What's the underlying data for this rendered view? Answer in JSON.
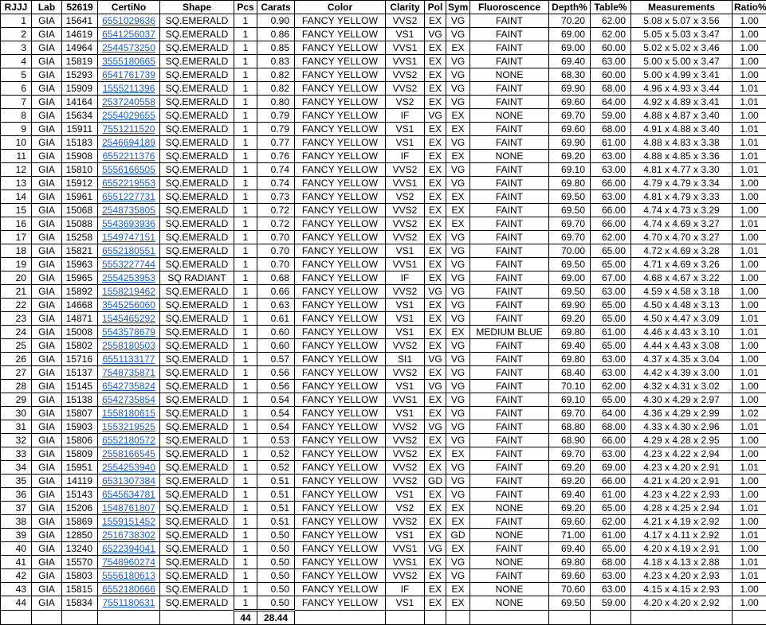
{
  "headers": [
    "RJJJ",
    "Lab",
    "52619",
    "CertiNo",
    "Shape",
    "Pcs",
    "Carats",
    "Color",
    "Clarity",
    "Pol",
    "Sym",
    "Fluoroscence",
    "Depth%",
    "Table%",
    "Measurements",
    "Ratio%"
  ],
  "rows": [
    [
      "1",
      "GIA",
      "15641",
      "6551029636",
      "SQ.EMERALD",
      "1",
      "0.90",
      "FANCY  YELLOW",
      "VVS2",
      "EX",
      "VG",
      "FAINT",
      "70.20",
      "62.00",
      "5.08 x 5.07 x 3.56",
      "1.00"
    ],
    [
      "2",
      "GIA",
      "14619",
      "6541256037",
      "SQ.EMERALD",
      "1",
      "0.86",
      "FANCY  YELLOW",
      "VS1",
      "VG",
      "VG",
      "FAINT",
      "69.00",
      "62.00",
      "5.05 x 5.03 x 3.47",
      "1.00"
    ],
    [
      "3",
      "GIA",
      "14964",
      "2544573250",
      "SQ.EMERALD",
      "1",
      "0.85",
      "FANCY  YELLOW",
      "VVS1",
      "EX",
      "EX",
      "FAINT",
      "69.00",
      "60.00",
      "5.02 x 5.02 x 3.46",
      "1.00"
    ],
    [
      "4",
      "GIA",
      "15819",
      "3555180665",
      "SQ.EMERALD",
      "1",
      "0.83",
      "FANCY  YELLOW",
      "VVS1",
      "EX",
      "VG",
      "FAINT",
      "69.40",
      "63.00",
      "5.00 x 5.00 x 3.47",
      "1.00"
    ],
    [
      "5",
      "GIA",
      "15293",
      "6541761739",
      "SQ.EMERALD",
      "1",
      "0.82",
      "FANCY  YELLOW",
      "VVS2",
      "EX",
      "VG",
      "NONE",
      "68.30",
      "60.00",
      "5.00 x 4.99 x 3.41",
      "1.00"
    ],
    [
      "6",
      "GIA",
      "15909",
      "1555211396",
      "SQ.EMERALD",
      "1",
      "0.82",
      "FANCY  YELLOW",
      "VVS2",
      "EX",
      "VG",
      "FAINT",
      "69.90",
      "68.00",
      "4.96 x 4.93 x 3.44",
      "1.01"
    ],
    [
      "7",
      "GIA",
      "14164",
      "2537240558",
      "SQ.EMERALD",
      "1",
      "0.80",
      "FANCY  YELLOW",
      "VS2",
      "EX",
      "VG",
      "FAINT",
      "69.60",
      "64.00",
      "4.92 x 4.89 x 3.41",
      "1.01"
    ],
    [
      "8",
      "GIA",
      "15634",
      "2554029655",
      "SQ.EMERALD",
      "1",
      "0.79",
      "FANCY  YELLOW",
      "IF",
      "VG",
      "EX",
      "NONE",
      "69.70",
      "59.00",
      "4.88 x 4.87 x 3.40",
      "1.00"
    ],
    [
      "9",
      "GIA",
      "15911",
      "7551211520",
      "SQ.EMERALD",
      "1",
      "0.79",
      "FANCY  YELLOW",
      "VS1",
      "EX",
      "EX",
      "FAINT",
      "69.60",
      "68.00",
      "4.91 x 4.88 x 3.40",
      "1.01"
    ],
    [
      "10",
      "GIA",
      "15183",
      "2546694189",
      "SQ.EMERALD",
      "1",
      "0.77",
      "FANCY  YELLOW",
      "VS1",
      "EX",
      "VG",
      "FAINT",
      "69.90",
      "61.00",
      "4.88 x 4.83 x 3.38",
      "1.01"
    ],
    [
      "11",
      "GIA",
      "15908",
      "6552211376",
      "SQ.EMERALD",
      "1",
      "0.76",
      "FANCY  YELLOW",
      "IF",
      "EX",
      "EX",
      "NONE",
      "69.20",
      "63.00",
      "4.88 x 4.85 x 3.36",
      "1.01"
    ],
    [
      "12",
      "GIA",
      "15810",
      "5556166505",
      "SQ.EMERALD",
      "1",
      "0.74",
      "FANCY  YELLOW",
      "VVS2",
      "EX",
      "VG",
      "FAINT",
      "69.10",
      "63.00",
      "4.81 x 4.77 x 3.30",
      "1.01"
    ],
    [
      "13",
      "GIA",
      "15912",
      "6552219553",
      "SQ.EMERALD",
      "1",
      "0.74",
      "FANCY  YELLOW",
      "VVS1",
      "EX",
      "VG",
      "FAINT",
      "69.80",
      "66.00",
      "4.79 x 4.79 x 3.34",
      "1.00"
    ],
    [
      "14",
      "GIA",
      "15961",
      "6551227731",
      "SQ.EMERALD",
      "1",
      "0.73",
      "FANCY  YELLOW",
      "VS2",
      "EX",
      "EX",
      "FAINT",
      "69.50",
      "63.00",
      "4.81 x 4.79 x 3.33",
      "1.00"
    ],
    [
      "15",
      "GIA",
      "15068",
      "2548735805",
      "SQ.EMERALD",
      "1",
      "0.72",
      "FANCY  YELLOW",
      "VVS2",
      "EX",
      "EX",
      "FAINT",
      "69.50",
      "66.00",
      "4.74 x 4.73 x 3.29",
      "1.00"
    ],
    [
      "16",
      "GIA",
      "15088",
      "5543693936",
      "SQ.EMERALD",
      "1",
      "0.72",
      "FANCY  YELLOW",
      "VVS2",
      "EX",
      "EX",
      "FAINT",
      "69.70",
      "66.00",
      "4.74 x 4.69 x 3.27",
      "1.01"
    ],
    [
      "17",
      "GIA",
      "15258",
      "1549747151",
      "SQ.EMERALD",
      "1",
      "0.70",
      "FANCY  YELLOW",
      "VVS2",
      "EX",
      "VG",
      "FAINT",
      "69.70",
      "62.00",
      "4.70 x 4.70 x 3.27",
      "1.00"
    ],
    [
      "18",
      "GIA",
      "15821",
      "6552180551",
      "SQ.EMERALD",
      "1",
      "0.70",
      "FANCY  YELLOW",
      "VS1",
      "EX",
      "VG",
      "FAINT",
      "70.00",
      "65.00",
      "4.72 x 4.69 x 3.28",
      "1.01"
    ],
    [
      "19",
      "GIA",
      "15963",
      "5553227744",
      "SQ.EMERALD",
      "1",
      "0.70",
      "FANCY  YELLOW",
      "VVS1",
      "EX",
      "VG",
      "FAINT",
      "69.50",
      "65.00",
      "4.71 x 4.69 x 3.26",
      "1.00"
    ],
    [
      "20",
      "GIA",
      "15965",
      "2554253953",
      "SQ RADIANT",
      "1",
      "0.68",
      "FANCY  YELLOW",
      "IF",
      "EX",
      "VG",
      "FAINT",
      "69.00",
      "67.00",
      "4.68 x 4.67 x 3.22",
      "1.00"
    ],
    [
      "21",
      "GIA",
      "15892",
      "1558219462",
      "SQ.EMERALD",
      "1",
      "0.66",
      "FANCY  YELLOW",
      "VVS2",
      "VG",
      "VG",
      "FAINT",
      "69.50",
      "63.00",
      "4.59 x 4.58 x 3.18",
      "1.00"
    ],
    [
      "22",
      "GIA",
      "14668",
      "3545256060",
      "SQ.EMERALD",
      "1",
      "0.63",
      "FANCY  YELLOW",
      "VS1",
      "EX",
      "VG",
      "FAINT",
      "69.90",
      "65.00",
      "4.50 x 4.48 x 3.13",
      "1.00"
    ],
    [
      "23",
      "GIA",
      "14871",
      "1545465292",
      "SQ.EMERALD",
      "1",
      "0.61",
      "FANCY  YELLOW",
      "VS1",
      "EX",
      "VG",
      "FAINT",
      "69.20",
      "65.00",
      "4.50 x 4.47 x 3.09",
      "1.01"
    ],
    [
      "24",
      "GIA",
      "15008",
      "5543578679",
      "SQ.EMERALD",
      "1",
      "0.60",
      "FANCY  YELLOW",
      "VS1",
      "EX",
      "EX",
      "MEDIUM BLUE",
      "69.80",
      "61.00",
      "4.46 x 4.43 x 3.10",
      "1.01"
    ],
    [
      "25",
      "GIA",
      "15802",
      "2558180503",
      "SQ.EMERALD",
      "1",
      "0.60",
      "FANCY  YELLOW",
      "VVS2",
      "EX",
      "VG",
      "FAINT",
      "69.40",
      "65.00",
      "4.44 x 4.43 x 3.08",
      "1.00"
    ],
    [
      "26",
      "GIA",
      "15716",
      "6551133177",
      "SQ.EMERALD",
      "1",
      "0.57",
      "FANCY  YELLOW",
      "SI1",
      "VG",
      "VG",
      "FAINT",
      "69.80",
      "63.00",
      "4.37 x 4.35 x 3.04",
      "1.00"
    ],
    [
      "27",
      "GIA",
      "15137",
      "7548735871",
      "SQ.EMERALD",
      "1",
      "0.56",
      "FANCY  YELLOW",
      "VVS2",
      "EX",
      "VG",
      "FAINT",
      "68.40",
      "63.00",
      "4.42 x 4.39 x 3.00",
      "1.01"
    ],
    [
      "28",
      "GIA",
      "15145",
      "6542735824",
      "SQ.EMERALD",
      "1",
      "0.56",
      "FANCY  YELLOW",
      "VS1",
      "VG",
      "VG",
      "FAINT",
      "70.10",
      "62.00",
      "4.32 x 4.31 x 3.02",
      "1.00"
    ],
    [
      "29",
      "GIA",
      "15138",
      "6542735854",
      "SQ.EMERALD",
      "1",
      "0.54",
      "FANCY  YELLOW",
      "VVS1",
      "EX",
      "VG",
      "FAINT",
      "69.10",
      "65.00",
      "4.30 x 4.29 x 2.97",
      "1.00"
    ],
    [
      "30",
      "GIA",
      "15807",
      "1558180615",
      "SQ.EMERALD",
      "1",
      "0.54",
      "FANCY  YELLOW",
      "VS1",
      "EX",
      "VG",
      "FAINT",
      "69.70",
      "64.00",
      "4.36 x 4.29 x 2.99",
      "1.02"
    ],
    [
      "31",
      "GIA",
      "15903",
      "1553219525",
      "SQ.EMERALD",
      "1",
      "0.54",
      "FANCY  YELLOW",
      "VVS2",
      "VG",
      "VG",
      "FAINT",
      "68.80",
      "68.00",
      "4.33 x 4.30 x 2.96",
      "1.01"
    ],
    [
      "32",
      "GIA",
      "15806",
      "6552180572",
      "SQ.EMERALD",
      "1",
      "0.53",
      "FANCY  YELLOW",
      "VVS2",
      "EX",
      "VG",
      "FAINT",
      "68.90",
      "66.00",
      "4.29 x 4.28 x 2.95",
      "1.00"
    ],
    [
      "33",
      "GIA",
      "15809",
      "2558166545",
      "SQ.EMERALD",
      "1",
      "0.52",
      "FANCY  YELLOW",
      "VVS2",
      "EX",
      "EX",
      "FAINT",
      "69.70",
      "63.00",
      "4.23 x 4.22 x 2.94",
      "1.00"
    ],
    [
      "34",
      "GIA",
      "15951",
      "2554253940",
      "SQ.EMERALD",
      "1",
      "0.52",
      "FANCY  YELLOW",
      "VVS2",
      "EX",
      "VG",
      "FAINT",
      "69.20",
      "69.00",
      "4.23 x 4.20 x 2.91",
      "1.01"
    ],
    [
      "35",
      "GIA",
      "14119",
      "6531307384",
      "SQ.EMERALD",
      "1",
      "0.51",
      "FANCY  YELLOW",
      "VVS2",
      "GD",
      "VG",
      "FAINT",
      "69.20",
      "66.00",
      "4.21 x 4.20 x 2.91",
      "1.00"
    ],
    [
      "36",
      "GIA",
      "15143",
      "6545634781",
      "SQ.EMERALD",
      "1",
      "0.51",
      "FANCY  YELLOW",
      "VS1",
      "EX",
      "VG",
      "FAINT",
      "69.40",
      "61.00",
      "4.23 x 4.22 x 2.93",
      "1.00"
    ],
    [
      "37",
      "GIA",
      "15206",
      "1548761807",
      "SQ.EMERALD",
      "1",
      "0.51",
      "FANCY  YELLOW",
      "VS2",
      "EX",
      "EX",
      "NONE",
      "69.20",
      "65.00",
      "4.28 x 4.25 x 2.94",
      "1.01"
    ],
    [
      "38",
      "GIA",
      "15869",
      "1559151452",
      "SQ.EMERALD",
      "1",
      "0.51",
      "FANCY  YELLOW",
      "VVS2",
      "EX",
      "EX",
      "FAINT",
      "69.60",
      "62.00",
      "4.21 x 4.19 x 2.92",
      "1.00"
    ],
    [
      "39",
      "GIA",
      "12850",
      "2516738302",
      "SQ.EMERALD",
      "1",
      "0.50",
      "FANCY  YELLOW",
      "VS1",
      "EX",
      "GD",
      "NONE",
      "71.00",
      "61.00",
      "4.17 x 4.11 x 2.92",
      "1.01"
    ],
    [
      "40",
      "GIA",
      "13240",
      "6522394041",
      "SQ.EMERALD",
      "1",
      "0.50",
      "FANCY  YELLOW",
      "VVS1",
      "VG",
      "EX",
      "FAINT",
      "69.40",
      "65.00",
      "4.20 x 4.19 x 2.91",
      "1.00"
    ],
    [
      "41",
      "GIA",
      "15570",
      "7548960274",
      "SQ.EMERALD",
      "1",
      "0.50",
      "FANCY  YELLOW",
      "VVS1",
      "EX",
      "VG",
      "NONE",
      "69.80",
      "68.00",
      "4.18 x 4.13 x 2.88",
      "1.01"
    ],
    [
      "42",
      "GIA",
      "15803",
      "5556180613",
      "SQ.EMERALD",
      "1",
      "0.50",
      "FANCY  YELLOW",
      "VVS2",
      "EX",
      "VG",
      "FAINT",
      "69.60",
      "63.00",
      "4.23 x 4.20 x 2.93",
      "1.01"
    ],
    [
      "43",
      "GIA",
      "15815",
      "6552180666",
      "SQ.EMERALD",
      "1",
      "0.50",
      "FANCY  YELLOW",
      "IF",
      "EX",
      "EX",
      "NONE",
      "70.60",
      "63.00",
      "4.15 x 4.15 x 2.93",
      "1.00"
    ],
    [
      "44",
      "GIA",
      "15834",
      "7551180631",
      "SQ.EMERALD",
      "1",
      "0.50",
      "FANCY  YELLOW",
      "VS1",
      "EX",
      "EX",
      "NONE",
      "69.50",
      "59.00",
      "4.20 x 4.20 x 2.92",
      "1.00"
    ]
  ],
  "totals": {
    "pcs": "44",
    "carats": "28.44"
  },
  "colors": {
    "link": "#1f5fbf",
    "border": "#000000"
  }
}
